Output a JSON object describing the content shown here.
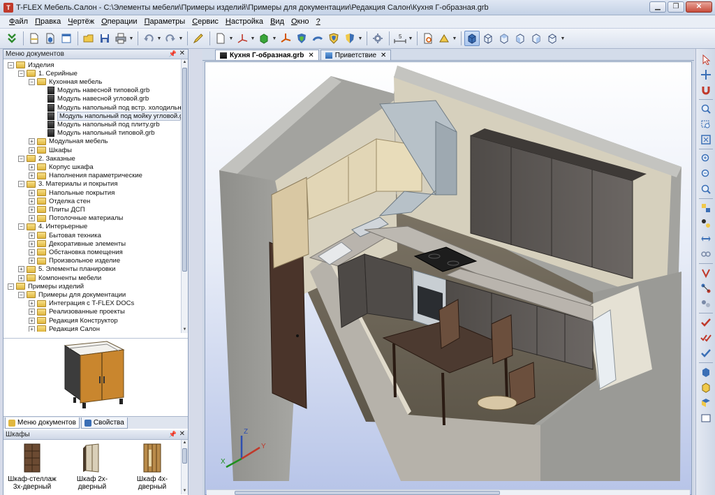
{
  "window": {
    "title": "T-FLEX Мебель.Салон - C:\\Элементы мебели\\Примеры изделий\\Примеры для документации\\Редакция Салон\\Кухня Г-образная.grb",
    "app_icon": "T",
    "controls": [
      "minimize-icon",
      "maximize-icon",
      "close-icon"
    ]
  },
  "menubar": {
    "items": [
      {
        "ul": "Ф",
        "rest": "айл"
      },
      {
        "ul": "П",
        "rest": "равка"
      },
      {
        "ul": "Ч",
        "rest": "ертёж"
      },
      {
        "ul": "О",
        "rest": "перации"
      },
      {
        "ul": "П",
        "rest": "араметры"
      },
      {
        "ul": "С",
        "rest": "ервис"
      },
      {
        "ul": "Н",
        "rest": "астройка"
      },
      {
        "ul": "В",
        "rest": "ид"
      },
      {
        "ul": "О",
        "rest": "кно"
      },
      {
        "ul": "?",
        "rest": ""
      }
    ]
  },
  "toolbar": {
    "buttons": [
      "double-chevron-icon",
      "new-document-icon",
      "new-3d-icon",
      "new-window-icon",
      "open-icon",
      "save-icon",
      "print-icon",
      "undo-icon",
      "redo-icon",
      "pencil-icon",
      "sheet-icon",
      "axes-icon",
      "green-box-icon",
      "coordinate-system-icon",
      "shield-icon",
      "arc-arrow-icon",
      "yellow-shield-icon",
      "dual-shield-icon",
      "gear-shield-icon",
      "dimension-icon",
      "measure-icon",
      "zoom-tool-icon",
      "view-front-icon",
      "view-iso-icon",
      "view-top-icon",
      "view-left-icon",
      "view-right-icon",
      "view-back-icon"
    ],
    "dimension_label": "5"
  },
  "documents_menu": {
    "title": "Меню документов",
    "tree": [
      {
        "level": 0,
        "type": "folder",
        "expander": "−",
        "label": "Изделия"
      },
      {
        "level": 1,
        "type": "folder",
        "expander": "−",
        "label": "1. Серийные"
      },
      {
        "level": 2,
        "type": "folder",
        "expander": "−",
        "label": "Кухонная мебель"
      },
      {
        "level": 3,
        "type": "doc",
        "expander": "",
        "label": "Модуль навесной типовой.grb"
      },
      {
        "level": 3,
        "type": "doc",
        "expander": "",
        "label": "Модуль навесной угловой.grb"
      },
      {
        "level": 3,
        "type": "doc",
        "expander": "",
        "label": "Модуль напольный под встр. холодильник..."
      },
      {
        "level": 3,
        "type": "doc",
        "expander": "",
        "label": "Модуль напольный под мойку угловой.grb",
        "selected": true
      },
      {
        "level": 3,
        "type": "doc",
        "expander": "",
        "label": "Модуль напольный под плиту.grb"
      },
      {
        "level": 3,
        "type": "doc",
        "expander": "",
        "label": "Модуль напольный типовой.grb"
      },
      {
        "level": 2,
        "type": "folder",
        "expander": "+",
        "label": "Модульная мебель"
      },
      {
        "level": 2,
        "type": "folder",
        "expander": "+",
        "label": "Шкафы"
      },
      {
        "level": 1,
        "type": "folder",
        "expander": "−",
        "label": "2. Заказные"
      },
      {
        "level": 2,
        "type": "folder",
        "expander": "+",
        "label": "Корпус шкафа"
      },
      {
        "level": 2,
        "type": "folder",
        "expander": "+",
        "label": "Наполнения параметрические"
      },
      {
        "level": 1,
        "type": "folder",
        "expander": "−",
        "label": "3. Материалы и покрытия"
      },
      {
        "level": 2,
        "type": "folder",
        "expander": "+",
        "label": "Напольные покрытия"
      },
      {
        "level": 2,
        "type": "folder",
        "expander": "+",
        "label": "Отделка стен"
      },
      {
        "level": 2,
        "type": "folder",
        "expander": "+",
        "label": "Плиты ДСП"
      },
      {
        "level": 2,
        "type": "folder",
        "expander": "+",
        "label": "Потолочные материалы"
      },
      {
        "level": 1,
        "type": "folder",
        "expander": "−",
        "label": "4. Интерьерные"
      },
      {
        "level": 2,
        "type": "folder",
        "expander": "+",
        "label": "Бытовая техника"
      },
      {
        "level": 2,
        "type": "folder",
        "expander": "+",
        "label": "Декоративные элементы"
      },
      {
        "level": 2,
        "type": "folder",
        "expander": "+",
        "label": "Обстановка помещения"
      },
      {
        "level": 2,
        "type": "folder",
        "expander": "+",
        "label": "Произвольное изделие"
      },
      {
        "level": 1,
        "type": "folder",
        "expander": "+",
        "label": "5. Элементы планировки"
      },
      {
        "level": 1,
        "type": "folder",
        "expander": "+",
        "label": "Компоненты мебели"
      },
      {
        "level": 0,
        "type": "folder",
        "expander": "−",
        "label": "Примеры изделий"
      },
      {
        "level": 1,
        "type": "folder",
        "expander": "−",
        "label": "Примеры для документации"
      },
      {
        "level": 2,
        "type": "folder",
        "expander": "+",
        "label": "Интеграция с T-FLEX DOCs"
      },
      {
        "level": 2,
        "type": "folder",
        "expander": "+",
        "label": "Реализованные проекты"
      },
      {
        "level": 2,
        "type": "folder",
        "expander": "+",
        "label": "Редакция Конструктор"
      },
      {
        "level": 2,
        "type": "folder",
        "expander": "+",
        "label": "Редакция Салон"
      }
    ]
  },
  "panel_tabs": [
    {
      "label": "Меню документов",
      "active": true,
      "icon": "documents-menu-icon"
    },
    {
      "label": "Свойства",
      "active": false,
      "icon": "properties-icon"
    }
  ],
  "library": {
    "title": "Шкафы",
    "items": [
      {
        "label": "Шкаф-стеллаж 3х-дверный",
        "icon": "rack-cabinet-icon"
      },
      {
        "label": "Шкаф 2х-дверный",
        "icon": "two-door-cabinet-icon"
      },
      {
        "label": "Шкаф 4х-дверный",
        "icon": "four-door-cabinet-icon"
      }
    ]
  },
  "document_tabs": [
    {
      "label": "Кухня Г-образная.grb",
      "active": true,
      "icon": "model-icon"
    },
    {
      "label": "Приветствие",
      "active": false,
      "icon": "welcome-icon"
    }
  ],
  "axes": {
    "x": "X",
    "y": "Y",
    "z": "Z"
  },
  "colors": {
    "wall": "#9a9a96",
    "cabinet": "#5a5653",
    "countertop": "#b7b3ad",
    "wood_door": "#4a342a",
    "accent_blue": "#3b6fb6"
  }
}
